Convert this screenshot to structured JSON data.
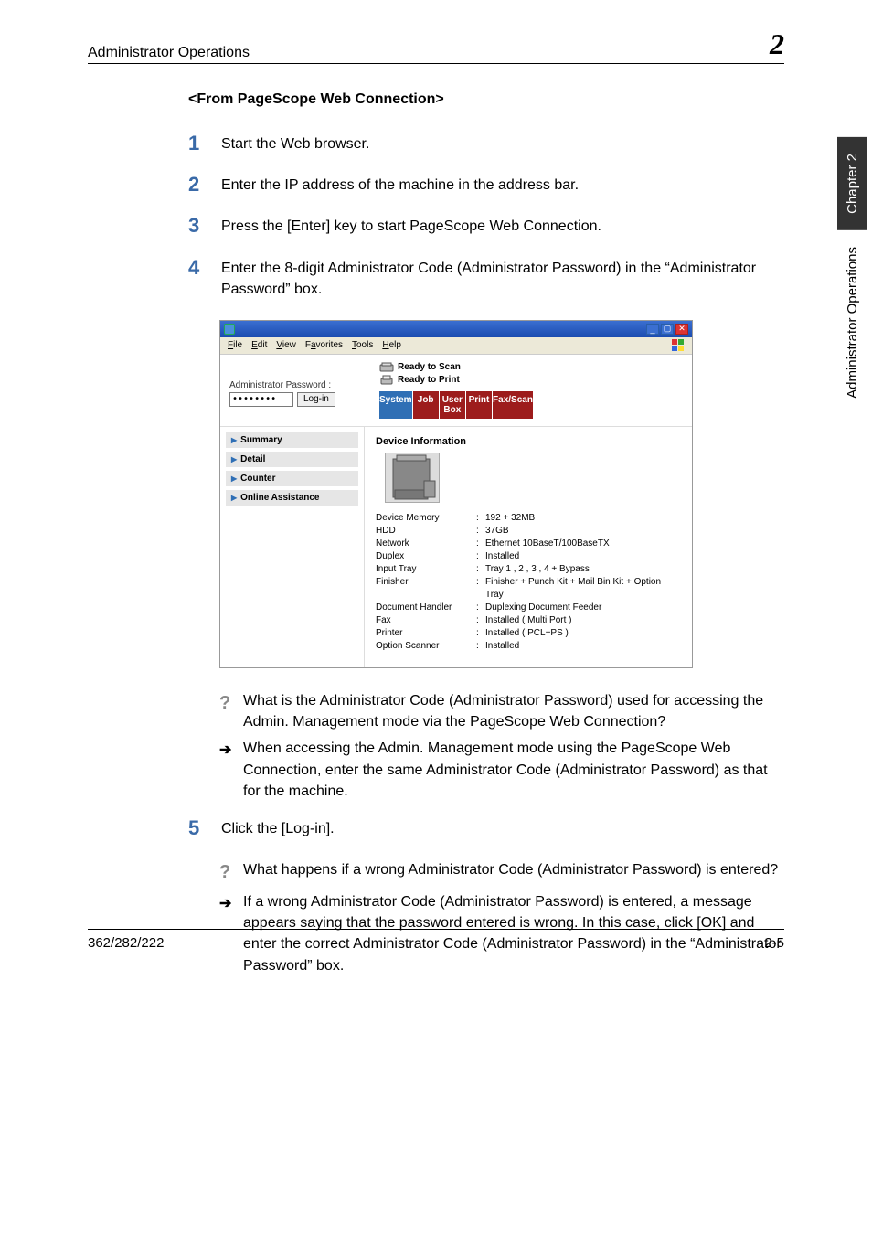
{
  "header": {
    "left": "Administrator Operations",
    "right": "2"
  },
  "sideTabs": {
    "dark": "Chapter 2",
    "light": "Administrator Operations"
  },
  "section_title": "<From PageScope Web Connection>",
  "steps": {
    "1": "Start the Web browser.",
    "2": "Enter the IP address of the machine in the address bar.",
    "3": "Press the [Enter] key to start PageScope Web Connection.",
    "4": "Enter the 8-digit Administrator Code (Administrator Password) in the “Administrator Password” box.",
    "5": "Click the [Log-in]."
  },
  "browser": {
    "menus": {
      "file": "File",
      "edit": "Edit",
      "view": "View",
      "favorites": "Favorites",
      "tools": "Tools",
      "help": "Help"
    },
    "status": {
      "scan": "Ready to Scan",
      "print": "Ready to Print"
    },
    "admin": {
      "label": "Administrator Password :",
      "value": "••••••••",
      "login": "Log-in"
    },
    "tabs": {
      "system": "System",
      "job": "Job",
      "userbox": "User Box",
      "print": "Print",
      "faxscan": "Fax/Scan"
    },
    "side": {
      "summary": "Summary",
      "detail": "Detail",
      "counter": "Counter",
      "online": "Online Assistance"
    },
    "main_title": "Device Information",
    "rows": [
      {
        "k": "Device Memory",
        "v": "192 + 32MB"
      },
      {
        "k": "HDD",
        "v": "37GB"
      },
      {
        "k": "Network",
        "v": "Ethernet 10BaseT/100BaseTX"
      },
      {
        "k": "Duplex",
        "v": "Installed"
      },
      {
        "k": "Input Tray",
        "v": "Tray 1 , 2 , 3 , 4 + Bypass"
      },
      {
        "k": "Finisher",
        "v": "Finisher + Punch Kit + Mail Bin Kit + Option Tray"
      },
      {
        "k": "Document Handler",
        "v": "Duplexing Document Feeder"
      },
      {
        "k": "Fax",
        "v": "Installed ( Multi Port )"
      },
      {
        "k": "Printer",
        "v": "Installed ( PCL+PS )"
      },
      {
        "k": "Option Scanner",
        "v": "Installed"
      }
    ]
  },
  "qa4": {
    "q": "What is the Administrator Code (Administrator Password) used for accessing the Admin. Management mode via the PageScope Web Connection?",
    "a": "When accessing the Admin. Management mode using the PageScope Web Connection, enter the same Administrator Code (Administrator Password) as that for the machine."
  },
  "qa5": {
    "q": "What happens if a wrong Administrator Code (Administrator Password) is entered?",
    "a": "If a wrong Administrator Code (Administrator Password) is entered, a message appears saying that the password entered is wrong. In this case, click [OK] and enter the correct Administrator Code (Administrator Password) in the “Administrator Password” box."
  },
  "footer": {
    "left": "362/282/222",
    "right": "2-5"
  }
}
